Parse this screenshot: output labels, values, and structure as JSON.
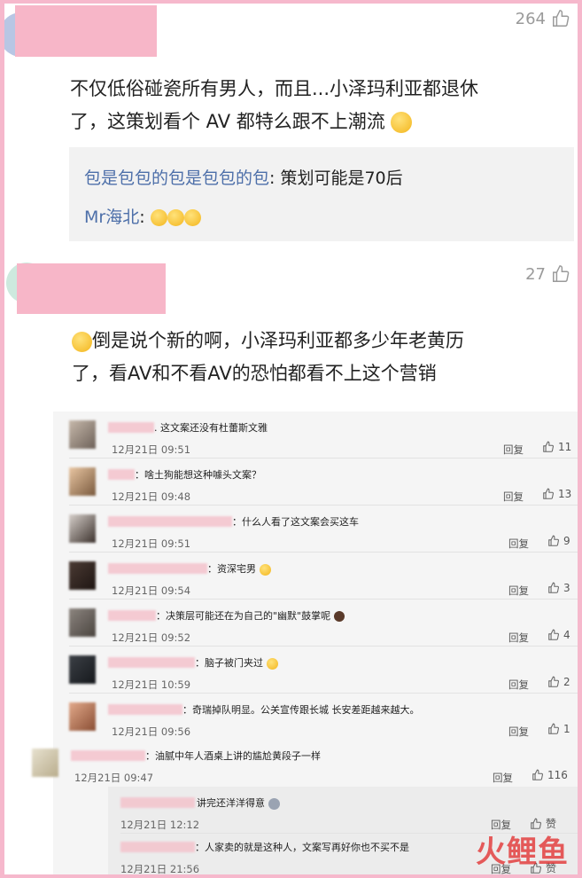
{
  "comment1": {
    "likes": "264",
    "text_line1": "不仅低俗碰瓷所有男人，而且...小泽玛利亚都退休",
    "text_line2": "了，这策划看个 AV 都特么跟不上潮流",
    "replies": [
      {
        "name": "包是包包的包是包包的包",
        "text": ": 策划可能是70后"
      },
      {
        "name": "Mr海北",
        "text": ":"
      }
    ]
  },
  "comment2": {
    "likes": "27",
    "text_line1": "倒是说个新的啊，小泽玛利亚都多少年老黄历",
    "text_line2": "了，看AV和不看AV的恐怕都看不上这个营销"
  },
  "list": {
    "reply_label": "回复",
    "items": [
      {
        "text": ". 这文案还没有杜蕾斯文雅",
        "time": "12月21日 09:51",
        "likes": "11"
      },
      {
        "text": "：啥土狗能想这种噱头文案？",
        "time": "12月21日 09:48",
        "likes": "13"
      },
      {
        "text": "：什么人看了这文案会买这车",
        "time": "12月21日 09:51",
        "likes": "9"
      },
      {
        "text": "：资深宅男",
        "time": "12月21日 09:54",
        "likes": "3"
      },
      {
        "text": "：决策层可能还在为自己的\"幽默\"鼓掌呢",
        "time": "12月21日 09:52",
        "likes": "4"
      },
      {
        "text": "：脑子被门夹过",
        "time": "12月21日 10:59",
        "likes": "2"
      },
      {
        "text": "：奇瑞掉队明显。公关宣传跟长城 长安差距越来越大。",
        "time": "12月21日 09:56",
        "likes": "1"
      },
      {
        "text": "：油腻中年人酒桌上讲的尴尬黄段子一样",
        "time": "12月21日 09:47",
        "likes": "116"
      }
    ],
    "nested": [
      {
        "text": "讲完还洋洋得意",
        "time": "12月21日 12:12",
        "likes": "赞"
      },
      {
        "text": "：人家卖的就是这种人，文案写再好你也不买不是",
        "time": "12月21日 21:56",
        "likes": "赞"
      }
    ]
  },
  "watermark": "火鲤鱼"
}
